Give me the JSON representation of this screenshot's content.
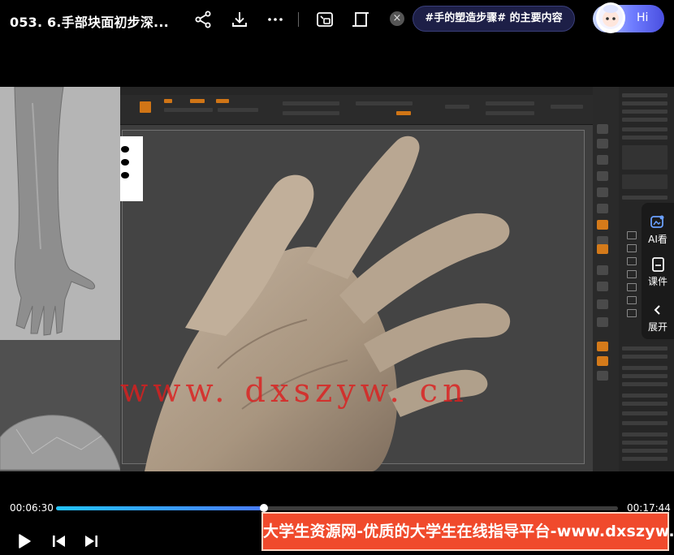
{
  "header": {
    "title": "053. 6.手部块面初步深...",
    "share_icon": "share-icon",
    "download_icon": "download-icon",
    "more_icon": "more-icon",
    "pip_icon": "picture-in-picture-icon",
    "fullscreen_icon": "fullscreen-icon",
    "close_icon": "close-icon",
    "close_glyph": "×",
    "ai_query": "#手的塑造步骤# 的主要内容",
    "assistant_label": "Hi"
  },
  "video": {
    "watermark": "www. dxszyw. cn"
  },
  "side_panel": {
    "items": [
      {
        "label": "AI看",
        "icon": "ai-watch-icon"
      },
      {
        "label": "课件",
        "icon": "courseware-icon"
      },
      {
        "label": "展开",
        "icon": "chevron-left-icon"
      }
    ]
  },
  "player": {
    "current_time": "00:06:30",
    "total_time": "00:17:44",
    "progress": 0.37,
    "play_icon": "play-icon",
    "prev_icon": "previous-icon",
    "next_icon": "next-icon"
  },
  "promo": {
    "text": "大学生资源网-优质的大学生在线指导平台-www.dxszyw.cn"
  },
  "colors": {
    "accent": "#3a8dff",
    "promo_bg": "#f04a2c",
    "watermark": "#dc1e1e",
    "zbrush_orange": "#d07516"
  }
}
